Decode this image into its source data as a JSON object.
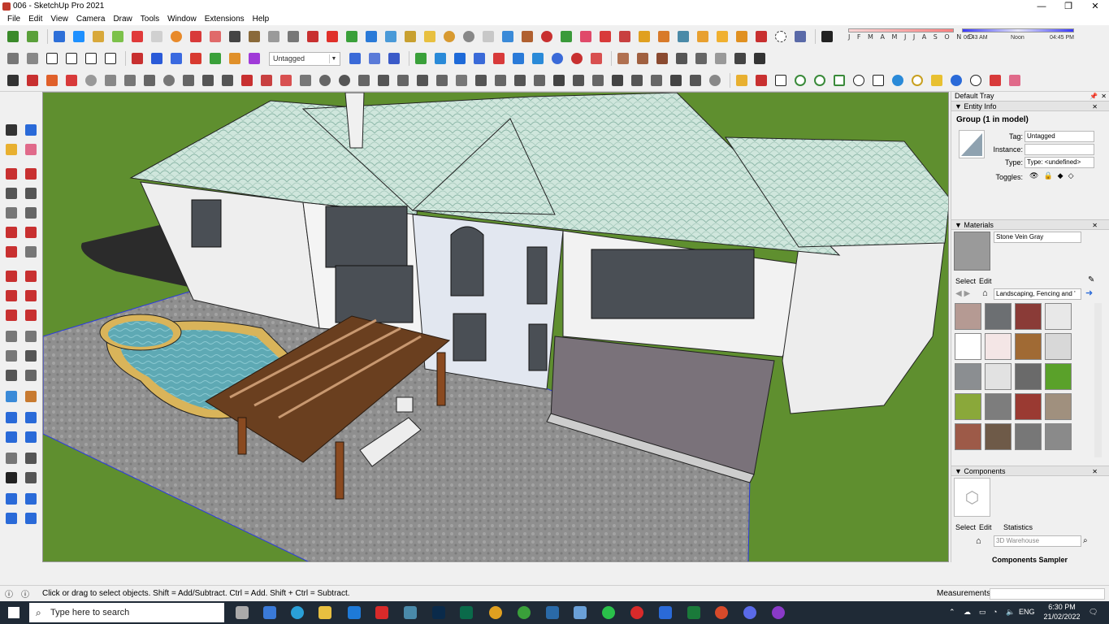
{
  "window": {
    "title": "006 - SketchUp Pro 2021",
    "controls": [
      "—",
      "❐",
      "✕"
    ]
  },
  "menu": [
    "File",
    "Edit",
    "View",
    "Camera",
    "Draw",
    "Tools",
    "Window",
    "Extensions",
    "Help"
  ],
  "toolbar": {
    "tag_select_value": "Untagged",
    "shadow_months": "J F M A M J J A S O N D",
    "shadow_time_start": "06:43 AM",
    "shadow_time_mid": "Noon",
    "shadow_time_end": "04:45 PM"
  },
  "tray": {
    "title": "Default Tray",
    "entity_info": {
      "header": "Entity Info",
      "selection": "Group (1 in model)",
      "tag_label": "Tag:",
      "tag_value": "Untagged",
      "instance_label": "Instance:",
      "instance_value": "",
      "type_label": "Type:",
      "type_value": "Type: <undefined>",
      "toggles_label": "Toggles:"
    },
    "materials": {
      "header": "Materials",
      "material_name": "Stone Vein Gray",
      "tab_select": "Select",
      "tab_edit": "Edit",
      "library": "Landscaping, Fencing and '",
      "swatch_colors": [
        "#b59a93",
        "#6c6f72",
        "#8a3b37",
        "#e8e8e8",
        "#ffffff",
        "#f4e6e6",
        "#a06a34",
        "#d8d8d8",
        "#8b8e91",
        "#e2e2e2",
        "#6a6a6a",
        "#5aa12a",
        "#8aa83a",
        "#7d7d7d",
        "#9a3a32",
        "#a0907e",
        "#9d5a48",
        "#6e5a48",
        "#777777",
        "#8a8a8a"
      ]
    },
    "components": {
      "header": "Components",
      "tab_select": "Select",
      "tab_edit": "Edit",
      "tab_statistics": "Statistics",
      "search_placeholder": "3D Warehouse",
      "collection_name": "Components Sampler"
    }
  },
  "status": {
    "hint": "Click or drag to select objects. Shift = Add/Subtract. Ctrl = Add. Shift + Ctrl = Subtract.",
    "measurements_label": "Measurements",
    "measurements_value": ""
  },
  "taskbar": {
    "search_placeholder": "Type here to search",
    "language": "ENG",
    "time": "6:30 PM",
    "date": "21/02/2022"
  }
}
